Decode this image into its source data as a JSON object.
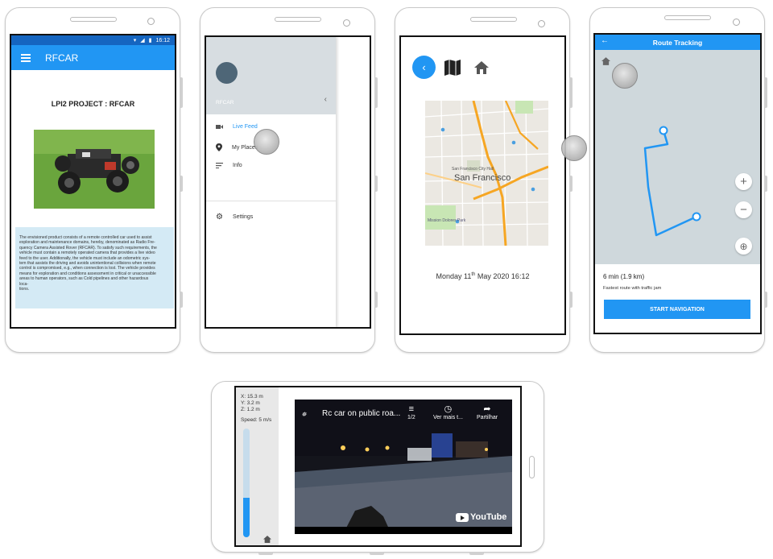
{
  "phone1": {
    "status_time": "16:12",
    "app_title": "RFCAR",
    "project_title": "LPI2 PROJECT : RFCAR",
    "description_lines": [
      "The envisioned product consists of a remote controlled car used to assist",
      "exploration and maintenance domains, hereby, denominated as Radio Fre-",
      "quency Camera Assisted Rover (RFCAR). To satisfy such requirements, the",
      "vehicle must contain a remotely operated camera that provides a live video",
      "feed to the user. Additionally, the vehicle must include an odometric sys-",
      "tem that assists the driving and avoids unintentional collisions when remote",
      "control is compromised, e.g., when connection is lost. The vehicle provides",
      "means for exploration and conditions assessment in critical or unaccessible",
      "areas to human operators, such as Cold pipelines and other hazardous",
      "loca-",
      "tions."
    ]
  },
  "phone2": {
    "drawer_name": "RFCAR",
    "items": [
      {
        "label": "Live Feed",
        "icon": "videocam-icon"
      },
      {
        "label": "My Places",
        "icon": "place-icon"
      },
      {
        "label": "Info",
        "icon": "list-icon"
      }
    ],
    "settings_label": "Settings"
  },
  "phone3": {
    "map_labels": {
      "city": "San Francisco",
      "civic": "San Francisco City Hall",
      "park": "Mission Dolores Park"
    },
    "date_prefix": "Monday 11",
    "date_sup": "th",
    "date_suffix": " May 2020 16:12"
  },
  "phone4": {
    "title": "Route Tracking",
    "duration": "6 min (1.9 km)",
    "route_note": "Fastest route with traffic jam",
    "button_label": "START NAVIGATION"
  },
  "landscape": {
    "x": "X: 15.3 m",
    "y": "Y:  3.2 m",
    "z": "Z:  1.2 m",
    "speed": "Speed: 5 m/s",
    "speed_fraction": 0.36,
    "video_title": "Rc car on public roa...",
    "queue_label": "1/2",
    "watch_later_label": "Ver mais t...",
    "share_label": "Partilhar",
    "youtube_label": "YouTube"
  }
}
